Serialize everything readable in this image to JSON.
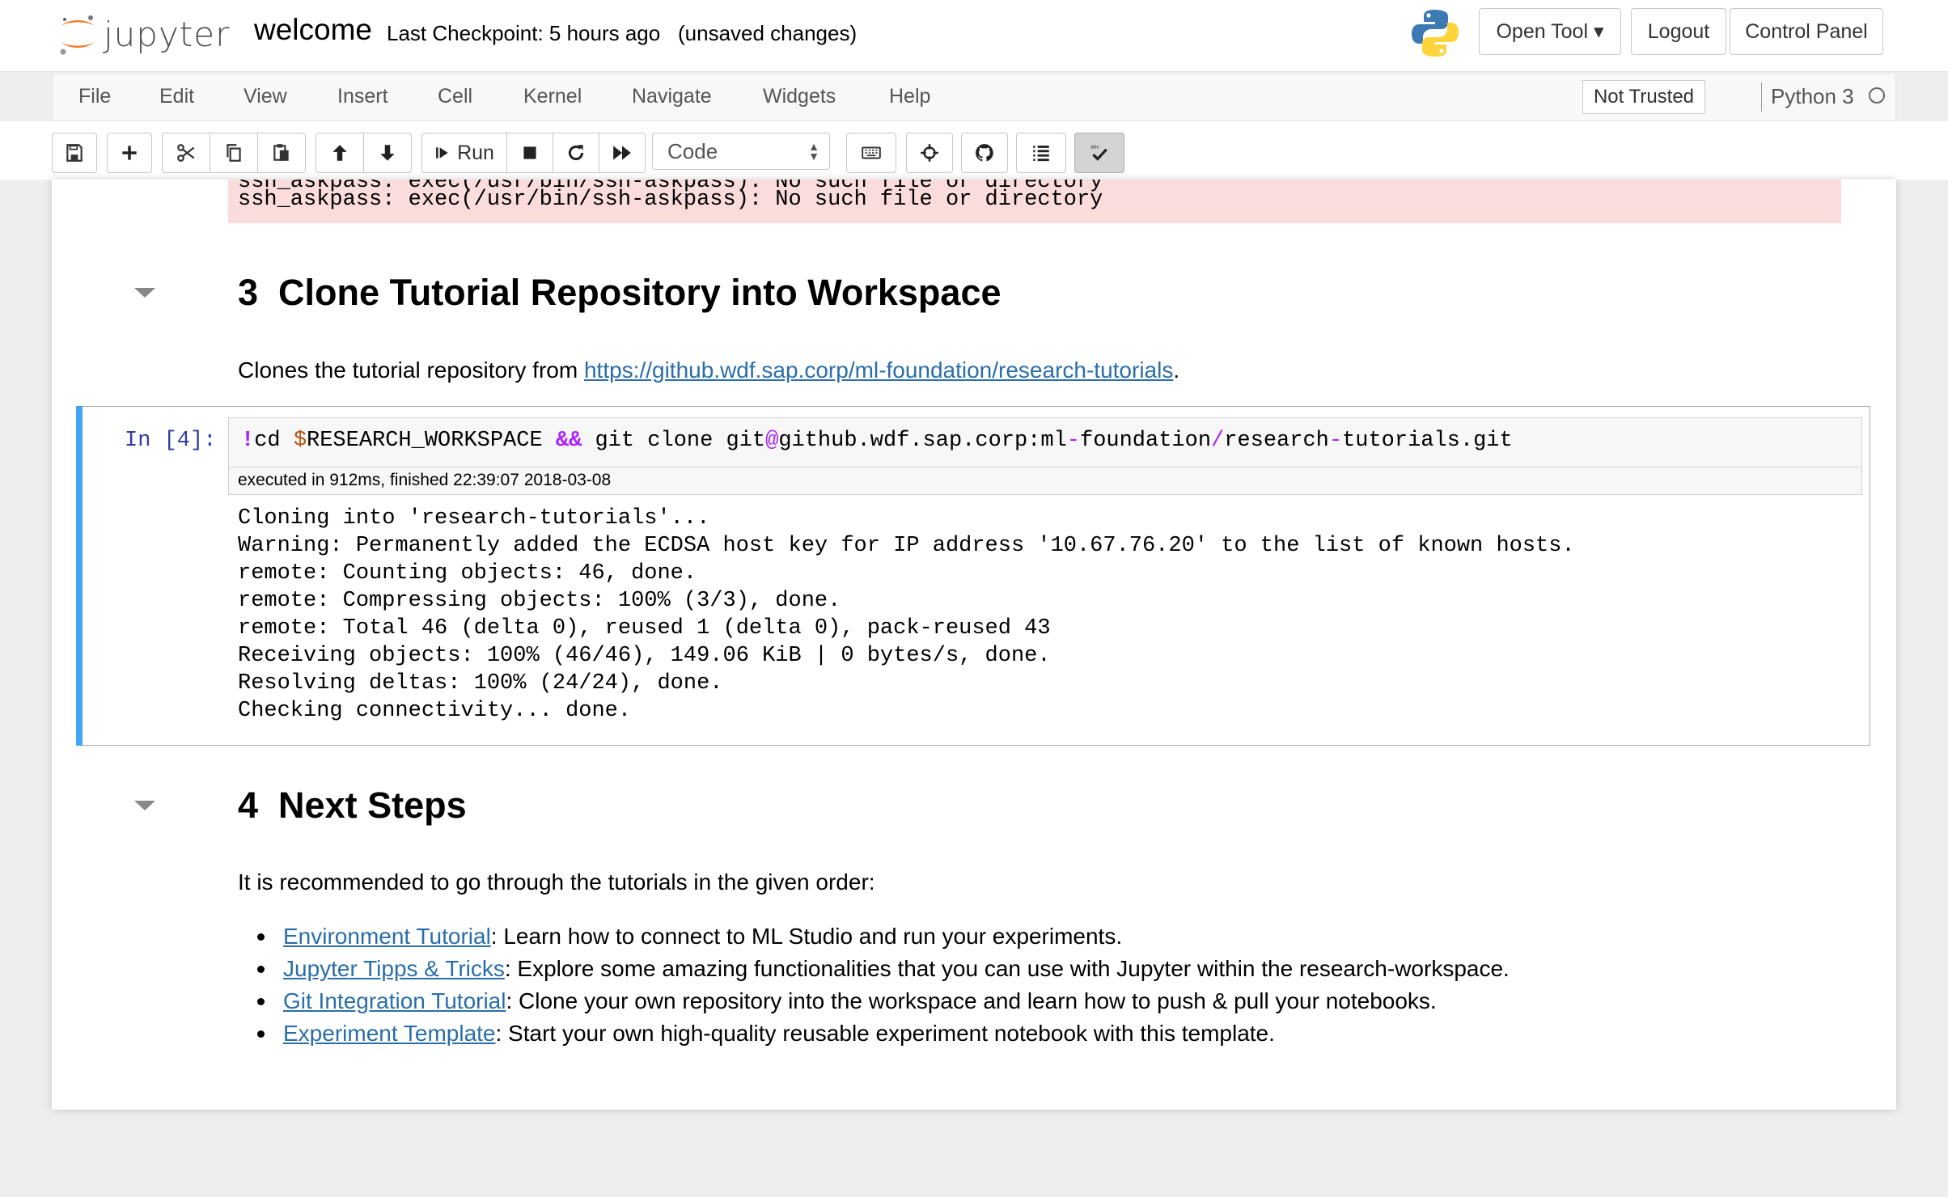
{
  "header": {
    "logo_text": "jupyter",
    "notebook_name": "welcome",
    "checkpoint": "Last Checkpoint: 5 hours ago",
    "status": "(unsaved changes)",
    "buttons": {
      "open_tool": "Open Tool ▾",
      "logout": "Logout",
      "control_panel": "Control Panel"
    }
  },
  "menubar": {
    "items": [
      "File",
      "Edit",
      "View",
      "Insert",
      "Cell",
      "Kernel",
      "Navigate",
      "Widgets",
      "Help"
    ],
    "trust": "Not Trusted",
    "kernel": "Python 3"
  },
  "toolbar": {
    "run_label": "Run",
    "cell_type": "Code",
    "icons": [
      "save-icon",
      "plus-icon",
      "cut-icon",
      "copy-icon",
      "paste-icon",
      "arrow-up-icon",
      "arrow-down-icon",
      "run-icon",
      "stop-icon",
      "restart-icon",
      "fast-forward-icon",
      "keyboard-icon",
      "crosshair-icon",
      "github-icon",
      "list-icon",
      "spellcheck-icon"
    ]
  },
  "notebook": {
    "error_partial": "ssh_askpass: exec(/usr/bin/ssh-askpass): No such file or directory",
    "error_line": "ssh_askpass: exec(/usr/bin/ssh-askpass): No such file or directory",
    "section3": {
      "number": "3",
      "title": "Clone Tutorial Repository into Workspace",
      "text": "Clones the tutorial repository from ",
      "link": "https://github.wdf.sap.corp/ml-foundation/research-tutorials",
      "text_end": "."
    },
    "cell4": {
      "prompt": "In [4]:",
      "code": {
        "bang": "!",
        "cmd": "cd ",
        "var": "$",
        "varname": "RESEARCH_WORKSPACE ",
        "and": "&&",
        "rest1": " git clone git",
        "at": "@",
        "rest2": "github.wdf.sap.corp:ml",
        "dash1": "-",
        "rest3": "foundation",
        "slash": "/",
        "rest4": "research",
        "dash2": "-",
        "rest5": "tutorials.git"
      },
      "exec_info": "executed in 912ms, finished 22:39:07 2018-03-08",
      "output": [
        "Cloning into 'research-tutorials'...",
        "Warning: Permanently added the ECDSA host key for IP address '10.67.76.20' to the list of known hosts.",
        "remote: Counting objects: 46, done.",
        "remote: Compressing objects: 100% (3/3), done.",
        "remote: Total 46 (delta 0), reused 1 (delta 0), pack-reused 43",
        "Receiving objects: 100% (46/46), 149.06 KiB | 0 bytes/s, done.",
        "Resolving deltas: 100% (24/24), done.",
        "Checking connectivity... done."
      ]
    },
    "section4": {
      "number": "4",
      "title": "Next Steps",
      "intro": "It is recommended to go through the tutorials in the given order:",
      "items": [
        {
          "link": "Environment Tutorial",
          "text": ": Learn how to connect to ML Studio and run your experiments."
        },
        {
          "link": "Jupyter Tipps & Tricks",
          "text": ": Explore some amazing functionalities that you can use with Jupyter within the research-workspace."
        },
        {
          "link": "Git Integration Tutorial",
          "text": ": Clone your own repository into the workspace and learn how to push & pull your notebooks."
        },
        {
          "link": "Experiment Template",
          "text": ": Start your own high-quality reusable experiment notebook with this template."
        }
      ]
    }
  },
  "colors": {
    "accent_blue": "#42a5f5",
    "link": "#296eaa",
    "prompt": "#303f9f",
    "error_bg": "#fbdcdc",
    "jupyter_orange": "#f37726"
  }
}
